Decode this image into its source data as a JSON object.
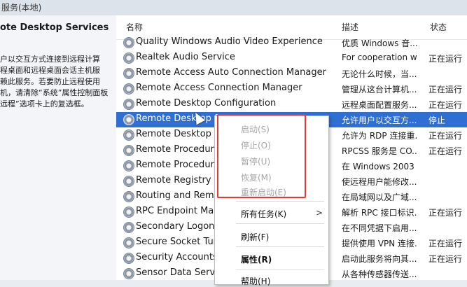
{
  "window": {
    "title_fragment": "服务(本地)"
  },
  "left_pane": {
    "title": "ote Desktop Services",
    "description_lines": [
      "户以交互方式连接到远程计算",
      "程桌面和远程桌面会话主机服",
      "赖此服务。若要防止远程使用",
      "机，请清除“系统”属性控制面板",
      "远程”选项卡上的复选框。"
    ]
  },
  "columns": {
    "name": "名称",
    "description": "描述",
    "status": "状态"
  },
  "rows": [
    {
      "name": "Quality Windows Audio Video Experience",
      "description": "优质 Windows 音...",
      "status": ""
    },
    {
      "name": "Realtek Audio Service",
      "description": "For cooperation w",
      "status": "正在运行"
    },
    {
      "name": "Remote Access Auto Connection Manager",
      "description": "无论什么时候，当...",
      "status": ""
    },
    {
      "name": "Remote Access Connection Manager",
      "description": "管理从这台计算机...",
      "status": "正在运行"
    },
    {
      "name": "Remote Desktop Configuration",
      "description": "远程桌面配置服务...",
      "status": "正在运行"
    },
    {
      "name": "Remote Desktop Services",
      "description": "允许用户以交互方...",
      "status": "停止",
      "selected": true
    },
    {
      "name": "Remote Desktop S",
      "description": "允许为 RDP 连接重...",
      "status": "正在运行"
    },
    {
      "name": "Remote Procedure",
      "description": "RPCSS 服务是 CO...",
      "status": "正在运行"
    },
    {
      "name": "Remote Procedure",
      "description": "在 Windows 2003 ...",
      "status": ""
    },
    {
      "name": "Remote Registry",
      "description": "使远程用户能修改...",
      "status": ""
    },
    {
      "name": "Routing and Remo",
      "description": "在局域网以及广域...",
      "status": ""
    },
    {
      "name": "RPC Endpoint Map",
      "description": "解析 RPC 接口标识...",
      "status": "正在运行"
    },
    {
      "name": "Secondary Logon",
      "description": "在不同凭据下启用...",
      "status": ""
    },
    {
      "name": "Secure Socket Tun",
      "description": "提供使用 VPN 连接...",
      "status": "正在运行"
    },
    {
      "name": "Security Accounts",
      "description": "启动此服务将向其...",
      "status": "正在运行"
    },
    {
      "name": "Sensor Data Servic",
      "description": "从各种传感器传送...",
      "status": ""
    }
  ],
  "context_menu": {
    "start": "启动(S)",
    "stop": "停止(O)",
    "pause": "暂停(U)",
    "resume": "恢复(M)",
    "restart": "重新启动(E)",
    "all_tasks": "所有任务(K)",
    "submenu_arrow": ">",
    "refresh": "刷新(F)",
    "properties": "属性(R)",
    "help": "帮助(H)"
  },
  "highlight_color": "#e53935",
  "selection_color": "#2f6fd1"
}
